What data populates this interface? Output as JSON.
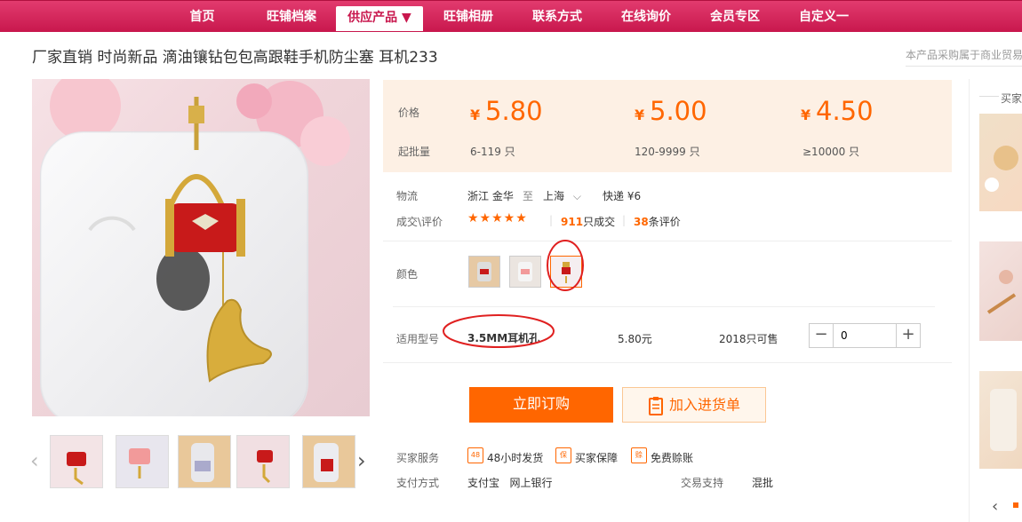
{
  "nav": {
    "items": [
      {
        "label": "首页"
      },
      {
        "label": "旺铺档案"
      },
      {
        "label": "供应产品 ▼"
      },
      {
        "label": "旺铺相册"
      },
      {
        "label": "联系方式"
      },
      {
        "label": "在线询价"
      },
      {
        "label": "会员专区"
      },
      {
        "label": "自定义一"
      }
    ],
    "active_index": 2
  },
  "product": {
    "title": "厂家直销 时尚新品 滴油镶钻包包高跟鞋手机防尘塞 耳机233",
    "notice": "本产品采购属于商业贸易"
  },
  "pricing": {
    "price_label": "价格",
    "moq_label": "起批量",
    "currency": "¥",
    "tiers": [
      {
        "price": "5.80",
        "moq": "6-119 只"
      },
      {
        "price": "5.00",
        "moq": "120-9999 只"
      },
      {
        "price": "4.50",
        "moq": "≥10000 只"
      }
    ]
  },
  "logistics": {
    "label": "物流",
    "from": "浙江 金华",
    "to_word": "至",
    "to": "上海",
    "express": "快递 ¥6"
  },
  "deals": {
    "label": "成交\\评价",
    "stars": "★★★★★",
    "sold_count": "911",
    "sold_suffix": "只成交",
    "review_count": "38",
    "review_suffix": "条评价"
  },
  "color": {
    "label": "颜色"
  },
  "model": {
    "label": "适用型号",
    "name": "3.5MM耳机孔",
    "price": "5.80元",
    "stock": "2018只可售",
    "quantity": "0",
    "minus": "−",
    "plus": "+"
  },
  "actions": {
    "buy_now": "立即订购",
    "add_to_list": "加入进货单"
  },
  "services": {
    "label": "买家服务",
    "items": [
      {
        "icon": "48",
        "text": "48小时发货"
      },
      {
        "icon": "保",
        "text": "买家保障"
      },
      {
        "icon": "赊",
        "text": "免费赊账"
      }
    ]
  },
  "payment": {
    "label": "支付方式",
    "methods": "支付宝   网上银行",
    "trade_label": "交易支持",
    "trade_value": "混批"
  },
  "sidebar": {
    "title": "买家"
  },
  "colors": {
    "accent": "#ff6600",
    "nav": "#c8174d",
    "annotation": "#e02020"
  }
}
